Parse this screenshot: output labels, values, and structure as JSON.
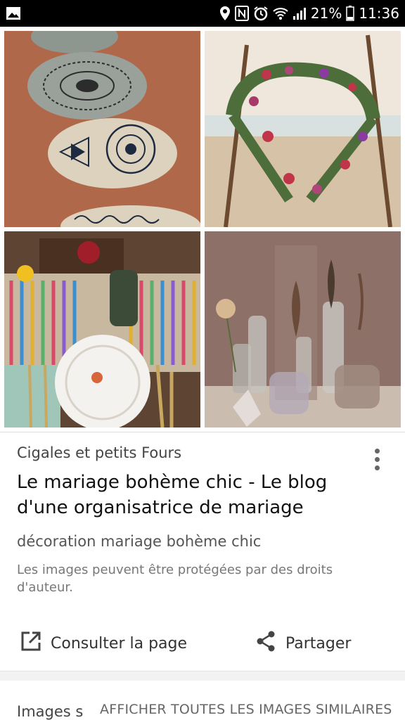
{
  "status_bar": {
    "battery": "21%",
    "time": "11:36",
    "icons": [
      "gallery-icon",
      "location-icon",
      "nfc-icon",
      "alarm-icon",
      "wifi-icon",
      "signal-icon",
      "battery-icon"
    ]
  },
  "images": [
    {
      "name": "painted-stones"
    },
    {
      "name": "flower-arch-beach"
    },
    {
      "name": "boho-table-setting"
    },
    {
      "name": "bottles-feathers"
    }
  ],
  "result": {
    "source": "Cigales et petits Fours",
    "title": "Le mariage bohème chic - Le blog d'une organisatrice de mariage",
    "query": "décoration mariage bohème chic",
    "copyright": "Les images peuvent être protégées par des droits d'auteur."
  },
  "actions": {
    "visit_label": "Consulter la page",
    "share_label": "Partager"
  },
  "bottom": {
    "label": "Images s",
    "link": "AFFICHER TOUTES LES IMAGES SIMILAIRES"
  }
}
